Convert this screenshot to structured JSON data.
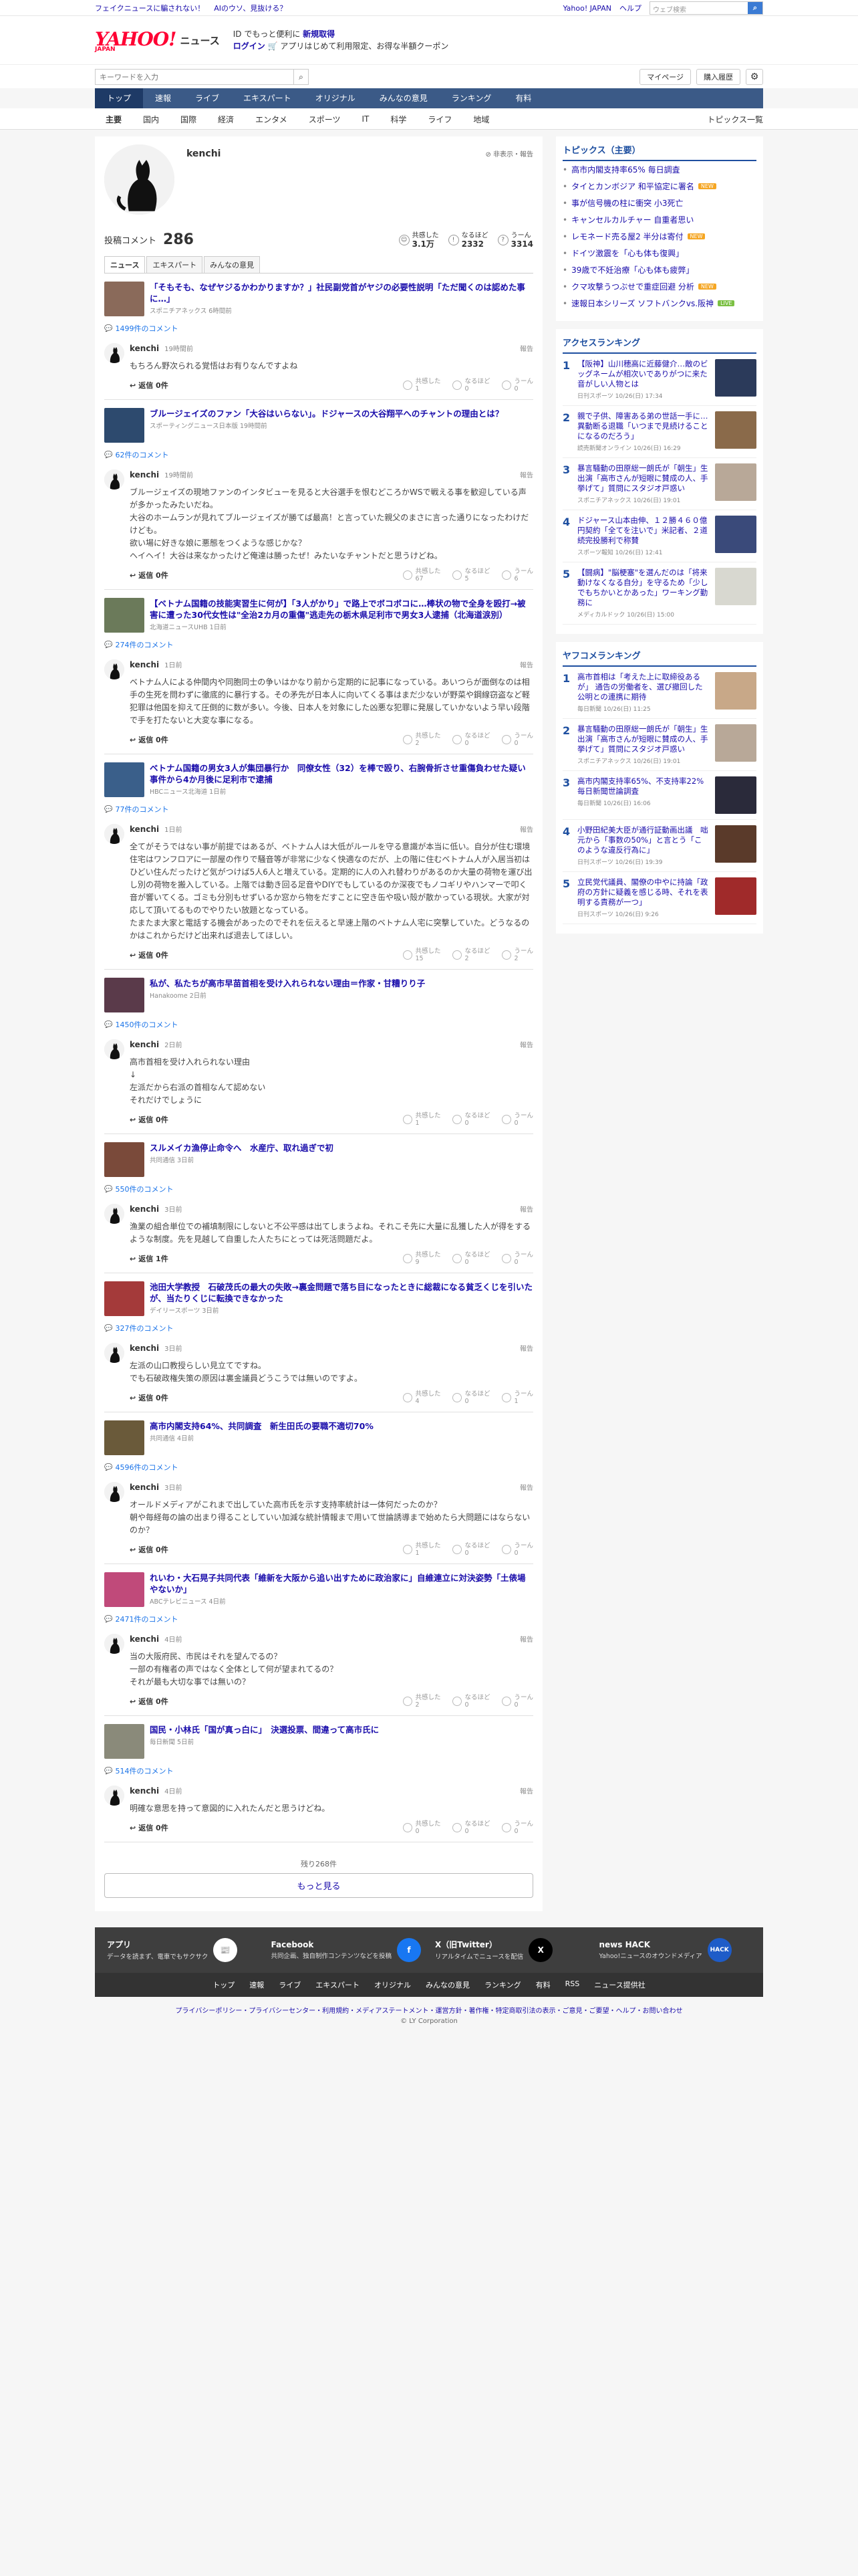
{
  "topbar": {
    "links": [
      "フェイクニュースに騙されない！",
      "AIのウソ、見抜ける？"
    ],
    "japan": "Yahoo! JAPAN",
    "help": "ヘルプ",
    "search_placeholder": "ウェブ検索",
    "search_hint": "キーワードを入力"
  },
  "header": {
    "logo": "YAHOO!",
    "logo_sub": "ニュース",
    "logo_small": "JAPAN",
    "promo_line1_a": "ID でもっと便利に",
    "promo_line1_b": "新規取得",
    "promo_line2_a": "ログイン",
    "promo_line2_b": "アプリはじめて利用限定、お得な半額クーポン"
  },
  "searchrow": {
    "placeholder": "キーワードを入力",
    "mypage": "マイページ",
    "purchased": "購入履歴"
  },
  "nav": [
    "トップ",
    "速報",
    "ライブ",
    "エキスパート",
    "オリジナル",
    "みんなの意見",
    "ランキング",
    "有料"
  ],
  "subnav": [
    "主要",
    "国内",
    "国際",
    "経済",
    "エンタメ",
    "スポーツ",
    "IT",
    "科学",
    "ライフ",
    "地域"
  ],
  "subnav_right": "トピックス一覧",
  "profile": {
    "name": "kenchi",
    "notice": "非表示・報告",
    "comments_label": "投稿コメント",
    "comments_count": "286",
    "react1_label": "共感した",
    "react1_count": "3.1万",
    "react2_label": "なるほど",
    "react2_count": "2332",
    "react3_label": "うーん",
    "react3_count": "3314",
    "tabs": [
      "ニュース",
      "エキスパート",
      "みんなの意見"
    ]
  },
  "ui": {
    "report": "報告",
    "reply": "返信",
    "vote1": "共感した",
    "vote2": "なるほど",
    "vote3": "うーん",
    "remaining": "残り268件",
    "more": "もっと見る"
  },
  "comments": [
    {
      "title": "「そもそも、なぜヤジるかわかりますか？」社民副党首がヤジの必要性説明「ただ聞くのは認めた事に…」",
      "source": "スポニチアネックス 6時間前",
      "count": "1499件のコメント",
      "date": "19時間前",
      "text": "もちろん野次られる覚悟はお有りなんですよね",
      "replies": "返信 0件",
      "v1": "1",
      "v2": "0",
      "v3": "0",
      "thumb": "#8a6a5a"
    },
    {
      "title": "ブルージェイズのファン「大谷はいらない」。ドジャースの大谷翔平へのチャントの理由とは？",
      "source": "スポーティングニュース日本版 19時間前",
      "count": "62件のコメント",
      "date": "19時間前",
      "text": "ブルージェイズの現地ファンのインタビューを見ると大谷選手を恨むどころかWSで戦える事を歓迎している声が多かったみたいだね。\n大谷のホームランが見れてブルージェイズが勝てば最高！と言っていた親父のまさに言った通りになったわけだけども。\n欲い場に好きな娘に悪態をつくような感じかな？\nヘイヘイ！大谷は来なかったけど俺達は勝ったぜ！みたいなチャントだと思うけどね。",
      "replies": "返信 0件",
      "v1": "67",
      "v2": "5",
      "v3": "6",
      "thumb": "#2d4a6e"
    },
    {
      "title": "【ベトナム国籍の技能実習生に何が】「3人がかり」で路上でボコボコに…棒状の物で全身を殴打→被害に遭った30代女性は\"全治2カ月の重傷\"逃走先の栃木県足利市で男女3人逮捕（北海道涙別）",
      "source": "北海道ニュースUHB 1日前",
      "count": "274件のコメント",
      "date": "1日前",
      "text": "ベトナム人による仲間内や同胞同士の争いはかなり前から定期的に記事になっている。あいつらが面倒なのは相手の生死を問わずに徹底的に暴行する。その矛先が日本人に向いてくる事はまだ少ないが野菜や鋼線窃盗など軽犯罪は他国を抑えて圧倒的に数が多い。今後、日本人を対象にした凶悪な犯罪に発展していかないよう早い段階で手を打たないと大変な事になる。",
      "replies": "返信 0件",
      "v1": "2",
      "v2": "0",
      "v3": "0",
      "thumb": "#6b7a5a"
    },
    {
      "title": "ベトナム国籍の男女3人が集団暴行か　同僚女性（32）を棒で殴り、右腕骨折させ重傷負わせた疑い　事件から4か月後に足利市で逮捕",
      "source": "HBCニュース北海道 1日前",
      "count": "77件のコメント",
      "date": "1日前",
      "text": "全てがそうではない事が前提ではあるが、ベトナム人は大低がルールを守る意識が本当に低い。自分が住む環境住宅はワンフロアに一部屋の作りで騒音等が非常に少なく快適なのだが、上の階に住むベトナム人が入居当初はひどい住んだったけど気がつけば5人6人と増えている。定期的に人の入れ替わりがあるのか大量の荷物を運び出し別の荷物を搬入している。上階では動き回る足音やDIYでもしているのか深夜でもノコギリやハンマーで叩く音が響いてくる。ゴミも分別もせずいるか窓から物をだすことに空き缶や吸い殻が散かっている現状。大家が対応して頂いてるものでやりたい放題となっている。\nたまたま大家と電話する機会があったのでそれを伝えると早速上階のベトナム人宅に突撃していた。どうなるのかはこれからだけど出来れば退去してほしい。",
      "replies": "返信 0件",
      "v1": "15",
      "v2": "2",
      "v3": "2",
      "thumb": "#3a5f8a"
    },
    {
      "title": "私が、私たちが高市早苗首相を受け入れられない理由＝作家・甘糟りり子",
      "source": "Hanakoome 2日前",
      "count": "1450件のコメント",
      "date": "2日前",
      "text": "高市首相を受け入れられない理由\n↓\n左派だから右派の首相なんて認めない\nそれだけでしょうに",
      "replies": "返信 0件",
      "v1": "1",
      "v2": "0",
      "v3": "0",
      "thumb": "#5a3a4a"
    },
    {
      "title": "スルメイカ漁停止命令へ　水産庁、取れ過ぎで初",
      "source": "共同通信 3日前",
      "count": "550件のコメント",
      "date": "3日前",
      "text": "漁業の組合単位での補填制限にしないと不公平感は出てしまうよね。それこそ先に大量に乱獲した人が得をするような制度。先を見越して自重した人たちにとっては死活問題だよ。",
      "replies": "返信 1件",
      "v1": "9",
      "v2": "0",
      "v3": "0",
      "thumb": "#7a4a3a"
    },
    {
      "title": "池田大学教授　石破茂氏の最大の失敗→裏金問題で落ち目になったときに総裁になる貧乏くじを引いたが、当たりくじに転換できなかった",
      "source": "デイリースポーツ 3日前",
      "count": "327件のコメント",
      "date": "3日前",
      "text": "左派の山口教授らしい見立てですね。\nでも石破政権失策の原因は裏金議員どうこうでは無いのですよ。",
      "replies": "返信 0件",
      "v1": "4",
      "v2": "0",
      "v3": "1",
      "thumb": "#a43a3a"
    },
    {
      "title": "高市内閣支持64%、共同調査　新生田氏の要職不適切70%",
      "source": "共同通信 4日前",
      "count": "4596件のコメント",
      "date": "3日前",
      "text": "オールドメディアがこれまで出していた高市氏を示す支持率統計は一体何だったのか？\n朝や毎経毎の論の出まり得ることしていい加減な統計情報まで用いて世論誘導まで始めたら大問題にはならないのか？",
      "replies": "返信 0件",
      "v1": "1",
      "v2": "0",
      "v3": "0",
      "thumb": "#6a5a3a"
    },
    {
      "title": "れいわ・大石晃子共同代表「維新を大阪から追い出すために政治家に」自維連立に対決姿勢「土俵場やないか」",
      "source": "ABCテレビニュース 4日前",
      "count": "2471件のコメント",
      "date": "4日前",
      "text": "当の大阪府民、市民はそれを望んでるの？\n一部の有権者の声ではなく全体として何が望まれてるの？\nそれが最も大切な事では無いの？",
      "replies": "返信 0件",
      "v1": "2",
      "v2": "0",
      "v3": "0",
      "thumb": "#c04a7a"
    },
    {
      "title": "国民・小林氏「国が真っ白に」　決選投票、間違って高市氏に",
      "source": "毎日新聞 5日前",
      "count": "514件のコメント",
      "date": "4日前",
      "text": "明確な意思を持って意図的に入れたんだと思うけどね。",
      "replies": "返信 0件",
      "v1": "0",
      "v2": "0",
      "v3": "0",
      "thumb": "#8a8a7a"
    }
  ],
  "topics": {
    "title": "トピックス（主要）",
    "items": [
      {
        "text": "高市内閣支持率65% 毎日調査",
        "tag": ""
      },
      {
        "text": "タイとカンボジア 和平協定に署名",
        "tag": "NEW"
      },
      {
        "text": "事が信号機の柱に衝突 小3死亡",
        "tag": ""
      },
      {
        "text": "キャンセルカルチャー 自重者思い",
        "tag": ""
      },
      {
        "text": "レモネード売る屋2 半分は寄付",
        "tag": "NEW"
      },
      {
        "text": "ドイツ激震を「心も体も復興」",
        "tag": ""
      },
      {
        "text": "39歳で不妊治療「心も体も疲弊」",
        "tag": ""
      },
      {
        "text": "クマ攻撃うつぶせで重症回避 分析",
        "tag": "NEW"
      },
      {
        "text": "速報日本シリーズ ソフトバンクvs.阪神",
        "tag": "LIVE"
      }
    ]
  },
  "access": {
    "title": "アクセスランキング",
    "items": [
      {
        "no": "1",
        "t": "【阪神】山川穂高に近藤健介…敵のビッグネームが相次いでありがつに来た音がしい人物とは",
        "s": "日刊スポーツ 10/26(日) 17:34",
        "c": "#2b3a5a"
      },
      {
        "no": "2",
        "t": "親で子供、障害ある弟の世話一手に…異動断る退職「いつまで見続けることになるのだろう」",
        "s": "読売新聞オンライン 10/26(日) 16:29",
        "c": "#8a6a4a"
      },
      {
        "no": "3",
        "t": "暴言騒動の田原総一朗氏が「朝生」生出演「高市さんが短眼に賛成の人、手挙げて」質問にスタジオ戸惑い",
        "s": "スポニチアネックス 10/26(日) 19:01",
        "c": "#b8a898"
      },
      {
        "no": "4",
        "t": "ドジャース山本由伸、１２勝４６０億円契約「全てを注いで」米記者、２道続完投勝利で称賛",
        "s": "スポーツ報知 10/26(日) 12:41",
        "c": "#3a4a7a"
      },
      {
        "no": "5",
        "t": "【闘病】\"脳梗塞\"を選んだのは「将来動けなくなる自分」を守るため「少しでもちかいとかあった」ワーキング勤務に",
        "s": "メディカルドック 10/26(日) 15:00",
        "c": "#d8d8d0"
      }
    ]
  },
  "yahoo_comment": {
    "title": "ヤフコメランキング",
    "items": [
      {
        "no": "1",
        "t": "高市首相は「考えた上に取締役あるが」 通告の労働者を、選び撤回した公明との連携に期待",
        "s": "毎日新聞 10/26(日) 11:25",
        "c": "#c8a888"
      },
      {
        "no": "2",
        "t": "暴言騒動の田原総一朗氏が「朝生」生出演「高市さんが短眼に賛成の人、手挙げて」質問にスタジオ戸惑い",
        "s": "スポニチアネックス 10/26(日) 19:01",
        "c": "#b8a898"
      },
      {
        "no": "3",
        "t": "高市内閣支持率65%、不支持率22%　毎日新聞世論調査",
        "s": "毎日新聞 10/26(日) 16:06",
        "c": "#2a2a3a"
      },
      {
        "no": "4",
        "t": "小野田紀美大臣が通行証動画出議　咄元から「事数の50%」と言とう「このような違反行為に」",
        "s": "日刊スポーツ 10/26(日) 19:39",
        "c": "#5a3a2a"
      },
      {
        "no": "5",
        "t": "立民党代議員、閣僚の中やに持論「政府の方針に疑義を感じる時、それを表明する責務が一つ」",
        "s": "日刊スポーツ 10/26(日) 9:26",
        "c": "#a02a2a"
      }
    ]
  },
  "footer": {
    "services": [
      {
        "h": "アプリ",
        "d": "データを読まず、電車でもサクサク",
        "ico": "📰",
        "bg": "#ffffff",
        "fg": "#cc0000"
      },
      {
        "h": "Facebook",
        "d": "共同企画、独自制作コンテンツなどを投稿",
        "ico": "f",
        "bg": "#1877f2",
        "fg": "#ffffff"
      },
      {
        "h": "X（旧Twitter）",
        "d": "リアルタイムでニュースを配信",
        "ico": "X",
        "bg": "#000000",
        "fg": "#ffffff"
      },
      {
        "h": "news HACK",
        "d": "Yahoo!ニュースのオウンドメディア",
        "ico": "HACK",
        "bg": "#1e5cc8",
        "fg": "#ffffff"
      }
    ],
    "nav": [
      "トップ",
      "速報",
      "ライブ",
      "エキスパート",
      "オリジナル",
      "みんなの意見",
      "ランキング",
      "有料",
      "RSS",
      "ニュース提供社"
    ],
    "legal": "プライバシーポリシー・プライバシーセンター・利用規約・メディアステートメント・運営方針・著作権・特定商取引法の表示・ご意見・ご要望・ヘルプ・お問い合わせ",
    "copy": "© LY Corporation"
  }
}
